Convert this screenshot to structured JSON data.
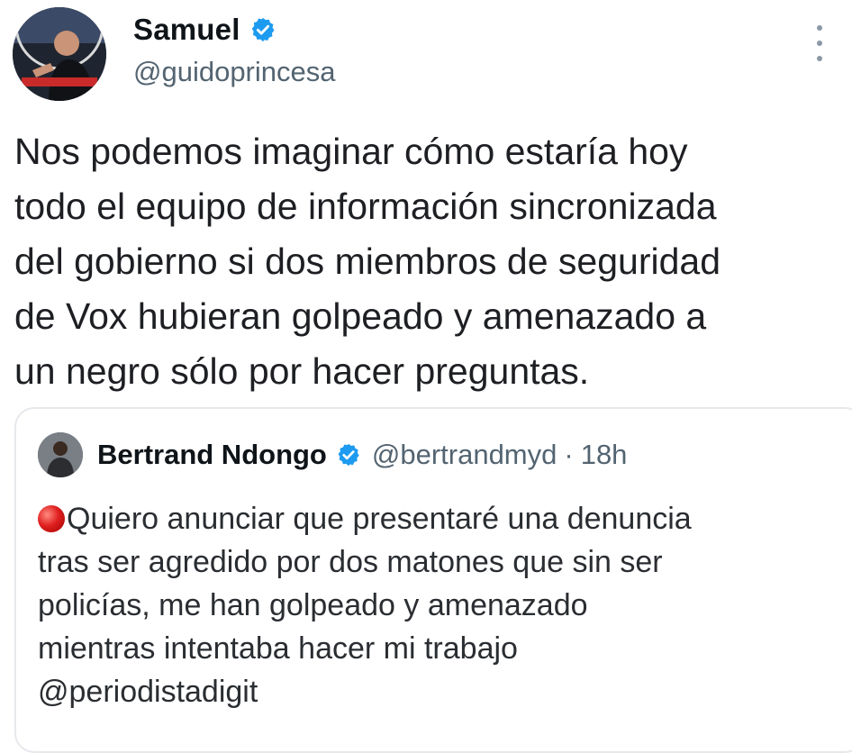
{
  "tweet": {
    "author": {
      "name": "Samuel",
      "handle": "@guidoprincesa",
      "verified_icon": "verified-badge-icon"
    },
    "text": "Nos podemos imaginar cómo estaría hoy\ntodo el equipo de información sincronizada\ndel gobierno si dos miembros de seguridad\nde Vox hubieran golpeado y amenazado a\nun negro sólo por hacer preguntas."
  },
  "quoted": {
    "author": {
      "name": "Bertrand Ndongo",
      "handle": "@bertrandmyd",
      "separator": "·",
      "time": "18h"
    },
    "bullet_icon": "red-circle-icon",
    "text_first_line": "Quiero anunciar que presentaré una denuncia",
    "text_rest": "tras ser agredido por dos matones que sin ser\npolicías, me han golpeado y amenazado\nmientras intentaba hacer mi trabajo\n@periodistadigit"
  },
  "colors": {
    "verified": "#1d9bf0",
    "secondary_text": "#536471",
    "border": "#e6e9ec"
  }
}
